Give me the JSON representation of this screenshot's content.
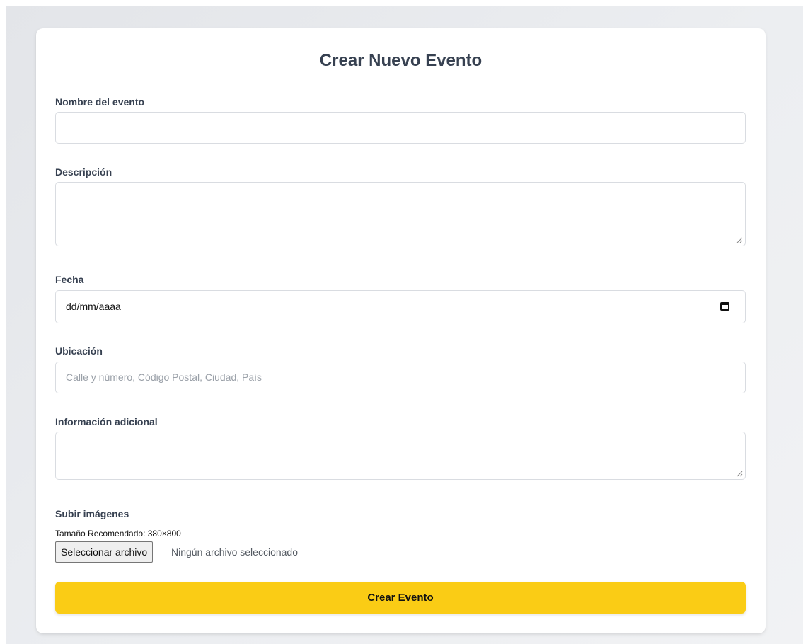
{
  "form": {
    "title": "Crear Nuevo Evento",
    "name_label": "Nombre del evento",
    "name_value": "",
    "description_label": "Descripción",
    "description_value": "",
    "date_label": "Fecha",
    "date_value": "dd/mm/aaaa",
    "location_label": "Ubicación",
    "location_placeholder": "Calle y número, Código Postal, Ciudad, País",
    "extra_info_label": "Información adicional",
    "extra_info_value": "",
    "images_label": "Subir imágenes",
    "images_hint": "Tamaño Recomendado: 380×800",
    "file_button_label": "Seleccionar archivo",
    "file_status": "Ningún archivo seleccionado",
    "submit_label": "Crear Evento"
  },
  "colors": {
    "accent": "#facc15",
    "text": "#374151",
    "border": "#d9dce1"
  },
  "icons": {
    "date_picker": "calendar-icon",
    "textarea_resize": "resize-grip-icon"
  }
}
